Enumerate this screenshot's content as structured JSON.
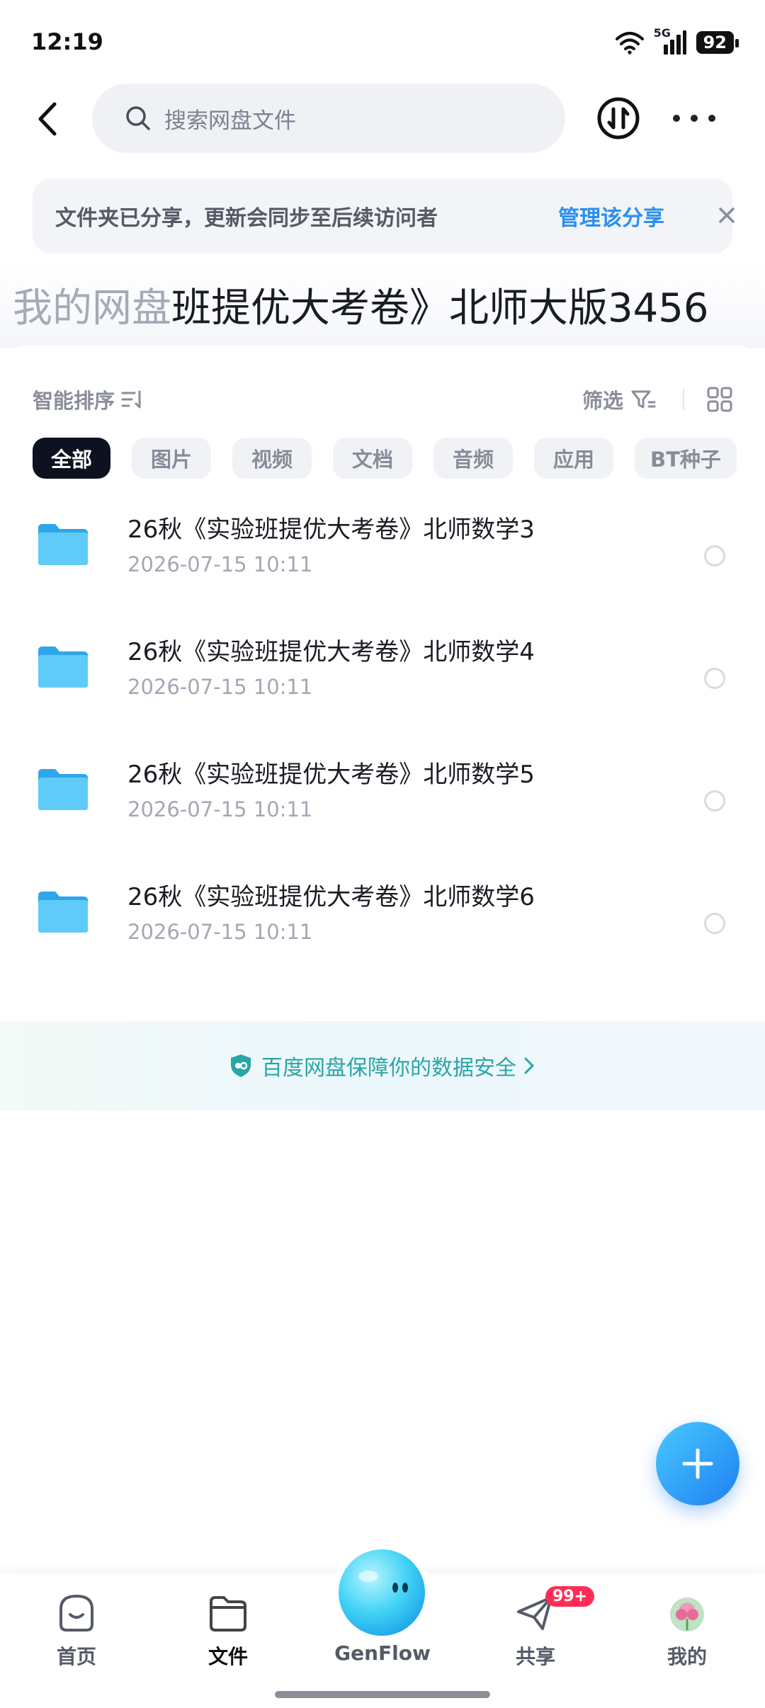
{
  "status_bar": {
    "time": "12:19",
    "network": "5G",
    "battery": "92"
  },
  "search": {
    "placeholder": "搜索网盘文件"
  },
  "share_banner": {
    "message": "文件夹已分享，更新会同步至后续访问者",
    "action": "管理该分享"
  },
  "path": {
    "parent": "我的网盘",
    "current": "班提优大考卷》北师大版3456"
  },
  "toolbar": {
    "sort_label": "智能排序",
    "filter_label": "筛选"
  },
  "filters": [
    "全部",
    "图片",
    "视频",
    "文档",
    "音频",
    "应用",
    "BT种子"
  ],
  "files": [
    {
      "name": "26秋《实验班提优大考卷》北师数学3",
      "date": "2026-07-15  10:11"
    },
    {
      "name": "26秋《实验班提优大考卷》北师数学4",
      "date": "2026-07-15  10:11"
    },
    {
      "name": "26秋《实验班提优大考卷》北师数学5",
      "date": "2026-07-15  10:11"
    },
    {
      "name": "26秋《实验班提优大考卷》北师数学6",
      "date": "2026-07-15  10:11"
    }
  ],
  "security": {
    "text": "百度网盘保障你的数据安全"
  },
  "tabs": [
    {
      "label": "首页"
    },
    {
      "label": "文件"
    },
    {
      "label": "GenFlow"
    },
    {
      "label": "共享",
      "badge": "99+"
    },
    {
      "label": "我的"
    }
  ],
  "colors": {
    "accent": "#2a8ff0",
    "security": "#2aa5a8",
    "badge": "#ff2d55",
    "chip_active": "#0d1220"
  }
}
